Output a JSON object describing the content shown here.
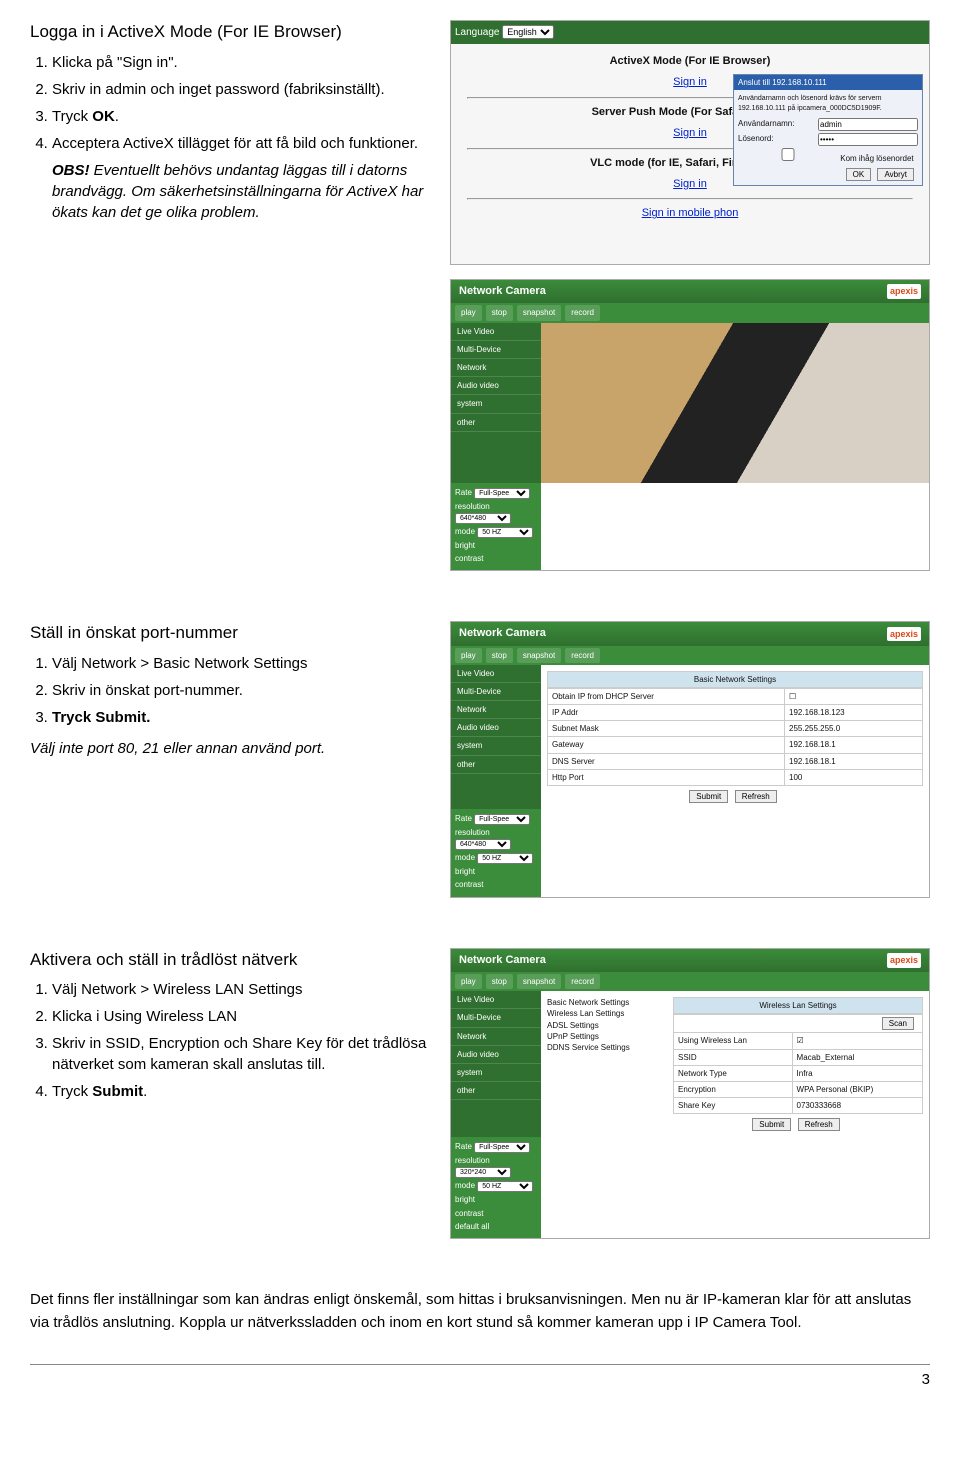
{
  "sec1": {
    "title": "Logga in  i ActiveX Mode (For IE Browser)",
    "li1": "Klicka på \"Sign in\".",
    "li2": "Skriv in admin och inget password (fabriksinställt).",
    "li3a": "Tryck ",
    "li3b": "OK",
    "li4": "Acceptera ActiveX tillägget för att få bild och funktioner.",
    "obs": "OBS!",
    "obs_body": " Eventuellt behövs undantag läggas till i datorns brandvägg. Om säkerhetsinställningarna för ActiveX har ökats kan det ge olika problem."
  },
  "sec2": {
    "title": "Ställ in önskat port-nummer",
    "li1": "Välj Network > Basic Network Settings",
    "li2": "Skriv in önskat port-nummer.",
    "li3a": "Tryck Submit.",
    "note": "Välj inte port 80, 21 eller annan använd port."
  },
  "sec3": {
    "title": "Aktivera och ställ in trådlöst nätverk",
    "li1": "Välj Network > Wireless LAN Settings",
    "li2": "Klicka i Using Wireless LAN",
    "li3": "Skriv in SSID, Encryption och Share Key för det trådlösa nätverket som kameran skall anslutas till.",
    "li4a": "Tryck ",
    "li4b": "Submit"
  },
  "footer": "Det finns fler inställningar som kan ändras enligt önskemål, som hittas i bruksanvisningen. Men nu är IP-kameran klar för att anslutas via trådlös anslutning. Koppla ur nätverkssladden och inom en kort stund så kommer kameran upp i IP Camera Tool.",
  "page_number": "3",
  "shot1": {
    "lang_label": "Language",
    "lang_value": "English",
    "mode_ax": "ActiveX Mode (For IE Browser)",
    "mode_push": "Server Push Mode (For Safari,FireFox",
    "mode_vlc": "VLC mode (for IE, Safari, FireFox, Goo",
    "mode_mobile": "Sign in mobile phon",
    "signin": "Sign in",
    "dlg_title": "Anslut till 192.168.10.111",
    "dlg_text": "Användarnamn och lösenord krävs för servern 192.168.10.111 på ipcamera_000DC5D1909F.",
    "dlg_user_l": "Användarnamn:",
    "dlg_user_v": "admin",
    "dlg_pw_l": "Lösenord:",
    "dlg_pw_v": "•••••",
    "dlg_remember": "Kom ihåg lösenordet",
    "ok": "OK",
    "cancel": "Avbryt"
  },
  "camshot": {
    "title": "Network Camera",
    "brand": "apexis",
    "btn_play": "play",
    "btn_stop": "stop",
    "btn_snap": "snapshot",
    "btn_rec": "record",
    "menu": [
      "Live Video",
      "Multi-Device",
      "Network",
      "Audio video",
      "system",
      "other"
    ],
    "rate_l": "Rate",
    "rate_v": "Full-Spee",
    "res_l": "resolution",
    "mode_l": "mode",
    "mode_v": "50 HZ",
    "bright": "bright",
    "contrast": "contrast",
    "default": "default all"
  },
  "shot2": {
    "panel_title": "Basic Network Settings",
    "rows": [
      [
        "Obtain IP from DHCP Server",
        "☐"
      ],
      [
        "IP Addr",
        "192.168.18.123"
      ],
      [
        "Subnet Mask",
        "255.255.255.0"
      ],
      [
        "Gateway",
        "192.168.18.1"
      ],
      [
        "DNS Server",
        "192.168.18.1"
      ],
      [
        "Http Port",
        "100"
      ]
    ],
    "res_v": "640*480",
    "submit": "Submit",
    "refresh": "Refresh"
  },
  "shot3": {
    "panel_title": "Wireless Lan Settings",
    "menu_extra": [
      "Basic Network Settings",
      "Wireless Lan Settings",
      "ADSL Settings",
      "UPnP Settings",
      "DDNS Service Settings"
    ],
    "rows": [
      [
        "Using Wireless Lan",
        "☑"
      ],
      [
        "SSID",
        "Macab_External"
      ],
      [
        "Network Type",
        "Infra"
      ],
      [
        "Encryption",
        "WPA Personal (BKIP)"
      ],
      [
        "Share Key",
        "0730333668"
      ]
    ],
    "scan": "Scan",
    "res_v": "320*240",
    "submit": "Submit",
    "refresh": "Refresh"
  }
}
